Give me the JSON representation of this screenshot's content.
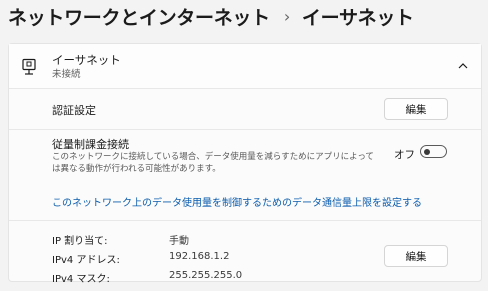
{
  "breadcrumb": {
    "parent": "ネットワークとインターネット",
    "separator": "›",
    "current": "イーサネット"
  },
  "header": {
    "title": "イーサネット",
    "subtitle": "未接続"
  },
  "auth": {
    "label": "認証設定",
    "button": "編集"
  },
  "metered": {
    "title": "従量制課金接続",
    "description": "このネットワークに接続している場合、データ使用量を減らすためにアプリによっては異なる動作が行われる可能性があります。",
    "toggle_label": "オフ",
    "toggle_on": false
  },
  "data_limit_link": "このネットワーク上のデータ使用量を制御するためのデータ通信量上限を設定する",
  "ip": {
    "assignment_label": "IP 割り当て:",
    "assignment_value": "手動",
    "address_label": "IPv4 アドレス:",
    "address_value": "192.168.1.2",
    "mask_label": "IPv4 マスク:",
    "mask_value": "255.255.255.0",
    "button": "編集"
  },
  "icons": {
    "ethernet": "ethernet-icon",
    "chevron": "chevron-up-icon"
  },
  "colors": {
    "link": "#0b5cad",
    "background": "#f3f3f3"
  }
}
